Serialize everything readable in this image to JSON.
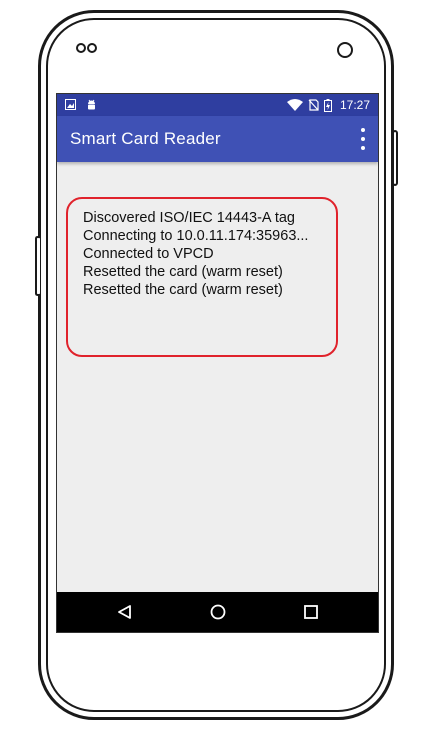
{
  "status_bar": {
    "time": "17:27",
    "left_icons": [
      "image-notification-icon",
      "android-debug-icon"
    ],
    "right_icons": [
      "wifi-icon",
      "no-sim-icon",
      "battery-charging-icon"
    ]
  },
  "app_bar": {
    "title": "Smart Card Reader",
    "menu_icon": "overflow-menu-icon"
  },
  "log_lines": [
    "Discovered ISO/IEC 14443-A tag",
    "Connecting to 10.0.11.174:35963...",
    "Connected to VPCD",
    "Resetted the card (warm reset)",
    "Resetted the card (warm reset)"
  ],
  "nav_bar": {
    "buttons": [
      "back-icon",
      "home-icon",
      "recents-icon"
    ]
  },
  "colors": {
    "app_bar": "#3f51b5",
    "status_bar": "#2f3ea0",
    "highlight": "#e0222b",
    "screen_background": "#eeeeee"
  }
}
